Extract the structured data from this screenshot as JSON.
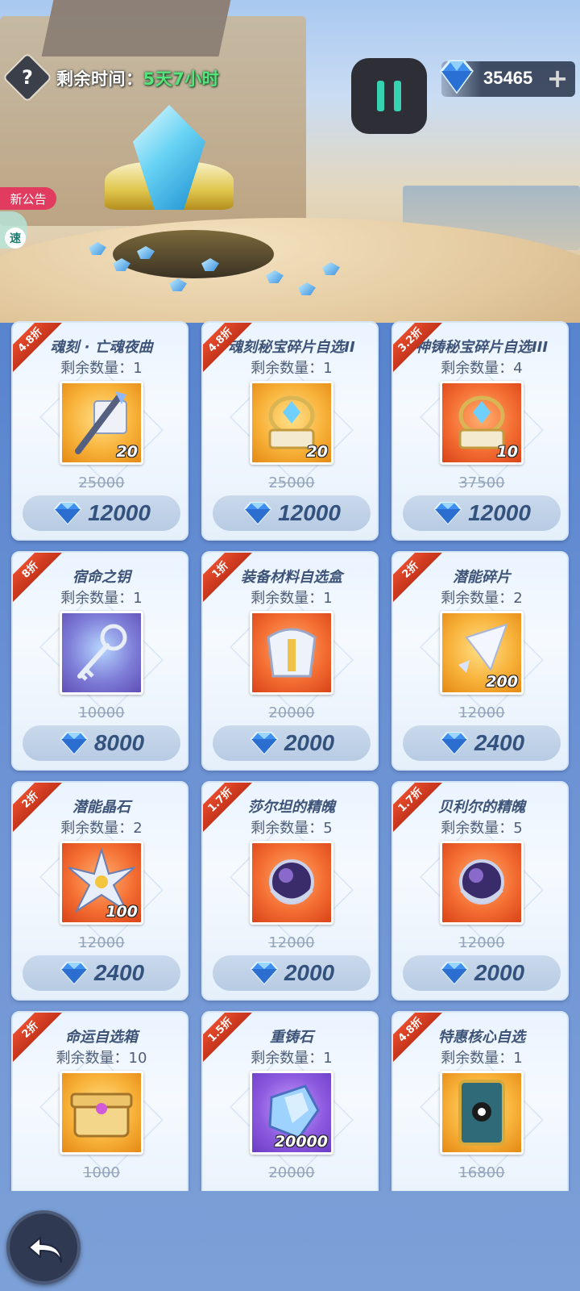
{
  "header": {
    "help_symbol": "?",
    "remain_label": "剩余时间：",
    "remain_value": "5天7小时",
    "currency_amount": "35465",
    "plus_symbol": "+",
    "notice_label": "新公告",
    "speed_label": "速"
  },
  "items": [
    {
      "discount": "4.8折",
      "name": "魂刻 · 亡魂夜曲",
      "qty": "剩余数量：1",
      "icon": "scroll-icon",
      "bg": "orange",
      "count": "20",
      "old_price": "25000",
      "price": "12000"
    },
    {
      "discount": "4.8折",
      "name": "魂刻秘宝碎片自选II",
      "qty": "剩余数量：1",
      "icon": "relic-icon",
      "bg": "orange",
      "count": "20",
      "old_price": "25000",
      "price": "12000"
    },
    {
      "discount": "3.2折",
      "name": "神铸秘宝碎片自选III",
      "qty": "剩余数量：4",
      "icon": "relic-icon",
      "bg": "red",
      "count": "10",
      "old_price": "37500",
      "price": "12000"
    },
    {
      "discount": "8折",
      "name": "宿命之钥",
      "qty": "剩余数量：1",
      "icon": "key-icon",
      "bg": "purple",
      "count": "",
      "old_price": "10000",
      "price": "8000"
    },
    {
      "discount": "1折",
      "name": "装备材料自选盒",
      "qty": "剩余数量：1",
      "icon": "armor-icon",
      "bg": "red",
      "count": "",
      "old_price": "20000",
      "price": "2000"
    },
    {
      "discount": "2折",
      "name": "潜能碎片",
      "qty": "剩余数量：2",
      "icon": "shard-icon",
      "bg": "orange",
      "count": "200",
      "old_price": "12000",
      "price": "2400"
    },
    {
      "discount": "2折",
      "name": "潜能晶石",
      "qty": "剩余数量：2",
      "icon": "star-crystal-icon",
      "bg": "red",
      "count": "100",
      "old_price": "12000",
      "price": "2400"
    },
    {
      "discount": "1.7折",
      "name": "莎尔坦的精魄",
      "qty": "剩余数量：5",
      "icon": "orb-icon",
      "bg": "red",
      "count": "",
      "old_price": "12000",
      "price": "2000"
    },
    {
      "discount": "1.7折",
      "name": "贝利尔的精魄",
      "qty": "剩余数量：5",
      "icon": "orb-icon",
      "bg": "red",
      "count": "",
      "old_price": "12000",
      "price": "2000"
    },
    {
      "discount": "2折",
      "name": "命运自选箱",
      "qty": "剩余数量：10",
      "icon": "chest-icon",
      "bg": "orange",
      "count": "",
      "old_price": "1000",
      "price": ""
    },
    {
      "discount": "1.5折",
      "name": "重铸石",
      "qty": "剩余数量：1",
      "icon": "stone-icon",
      "bg": "violet",
      "count": "20000",
      "old_price": "20000",
      "price": ""
    },
    {
      "discount": "4.8折",
      "name": "特惠核心自选",
      "qty": "剩余数量：1",
      "icon": "card-icon",
      "bg": "orange",
      "count": "",
      "old_price": "16800",
      "price": ""
    }
  ],
  "colors": {
    "ribbon": "#d63c20",
    "remain_value": "#56e47c",
    "pause_accent": "#35d3b1",
    "price_text": "#33527e"
  }
}
